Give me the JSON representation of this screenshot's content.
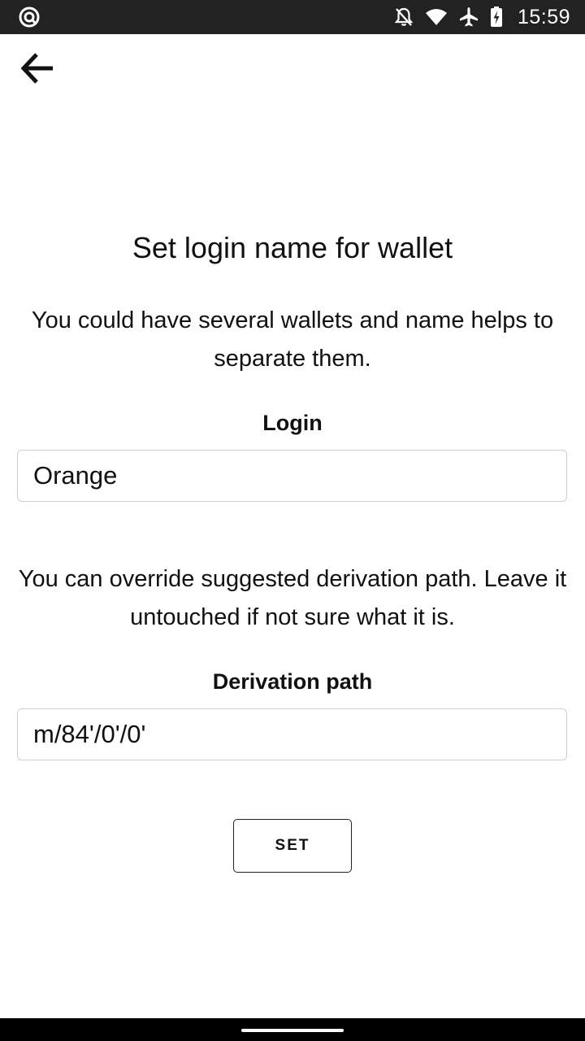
{
  "status_bar": {
    "time": "15:59",
    "icons": [
      "app-notification-icon",
      "notifications-off-icon",
      "wifi-icon",
      "airplane-mode-icon",
      "battery-charging-icon"
    ]
  },
  "header": {
    "back_icon": "arrow-left-icon"
  },
  "main": {
    "title": "Set login name for wallet",
    "description_login": "You could have several wallets and name helps to separate them.",
    "login": {
      "label": "Login",
      "value": "Orange"
    },
    "description_derivation": "You can override suggested derivation path. Leave it untouched if not sure what it is.",
    "derivation": {
      "label": "Derivation path",
      "value": "m/84'/0'/0'"
    },
    "set_button": "SET"
  },
  "colors": {
    "status_bar_bg": "#222222",
    "background": "#ffffff",
    "text": "#111111",
    "input_border": "#cfcfcf",
    "nav_bar_bg": "#000000"
  }
}
